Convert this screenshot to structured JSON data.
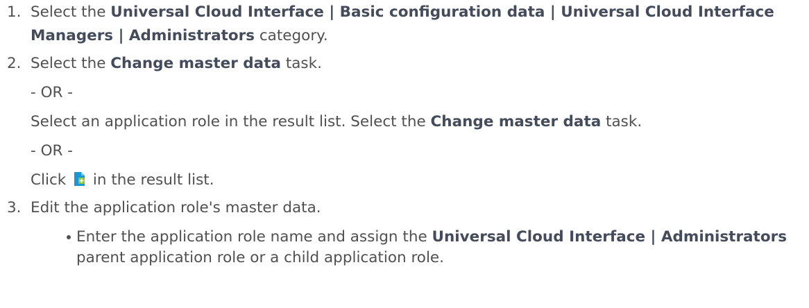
{
  "steps": [
    {
      "number": "1.",
      "pre": "Select the ",
      "bold": "Universal Cloud Interface | Basic configuration data | Universal Cloud Interface Managers | Administrators",
      "post": " category."
    },
    {
      "number": "2.",
      "line1": {
        "pre": "Select the ",
        "bold": "Change master data",
        "post": " task."
      },
      "or1": "- OR -",
      "line2": {
        "pre": "Select an application role in the result list. Select the ",
        "bold": "Change master data",
        "post": " task."
      },
      "or2": "- OR -",
      "line3": {
        "pre": "Click ",
        "post": " in the result list.",
        "icon": "add-document-icon"
      }
    },
    {
      "number": "3.",
      "text": "Edit the application role's master data.",
      "bullet": {
        "pre": "Enter the application role name and assign the ",
        "bold": "Universal Cloud Interface | Administrators",
        "post": " parent application role or a child application role."
      }
    }
  ],
  "colors": {
    "text": "#505050",
    "bold_text": "#444b5b",
    "icon_page": "#1a98d5",
    "icon_plus": "#8cc63f"
  }
}
